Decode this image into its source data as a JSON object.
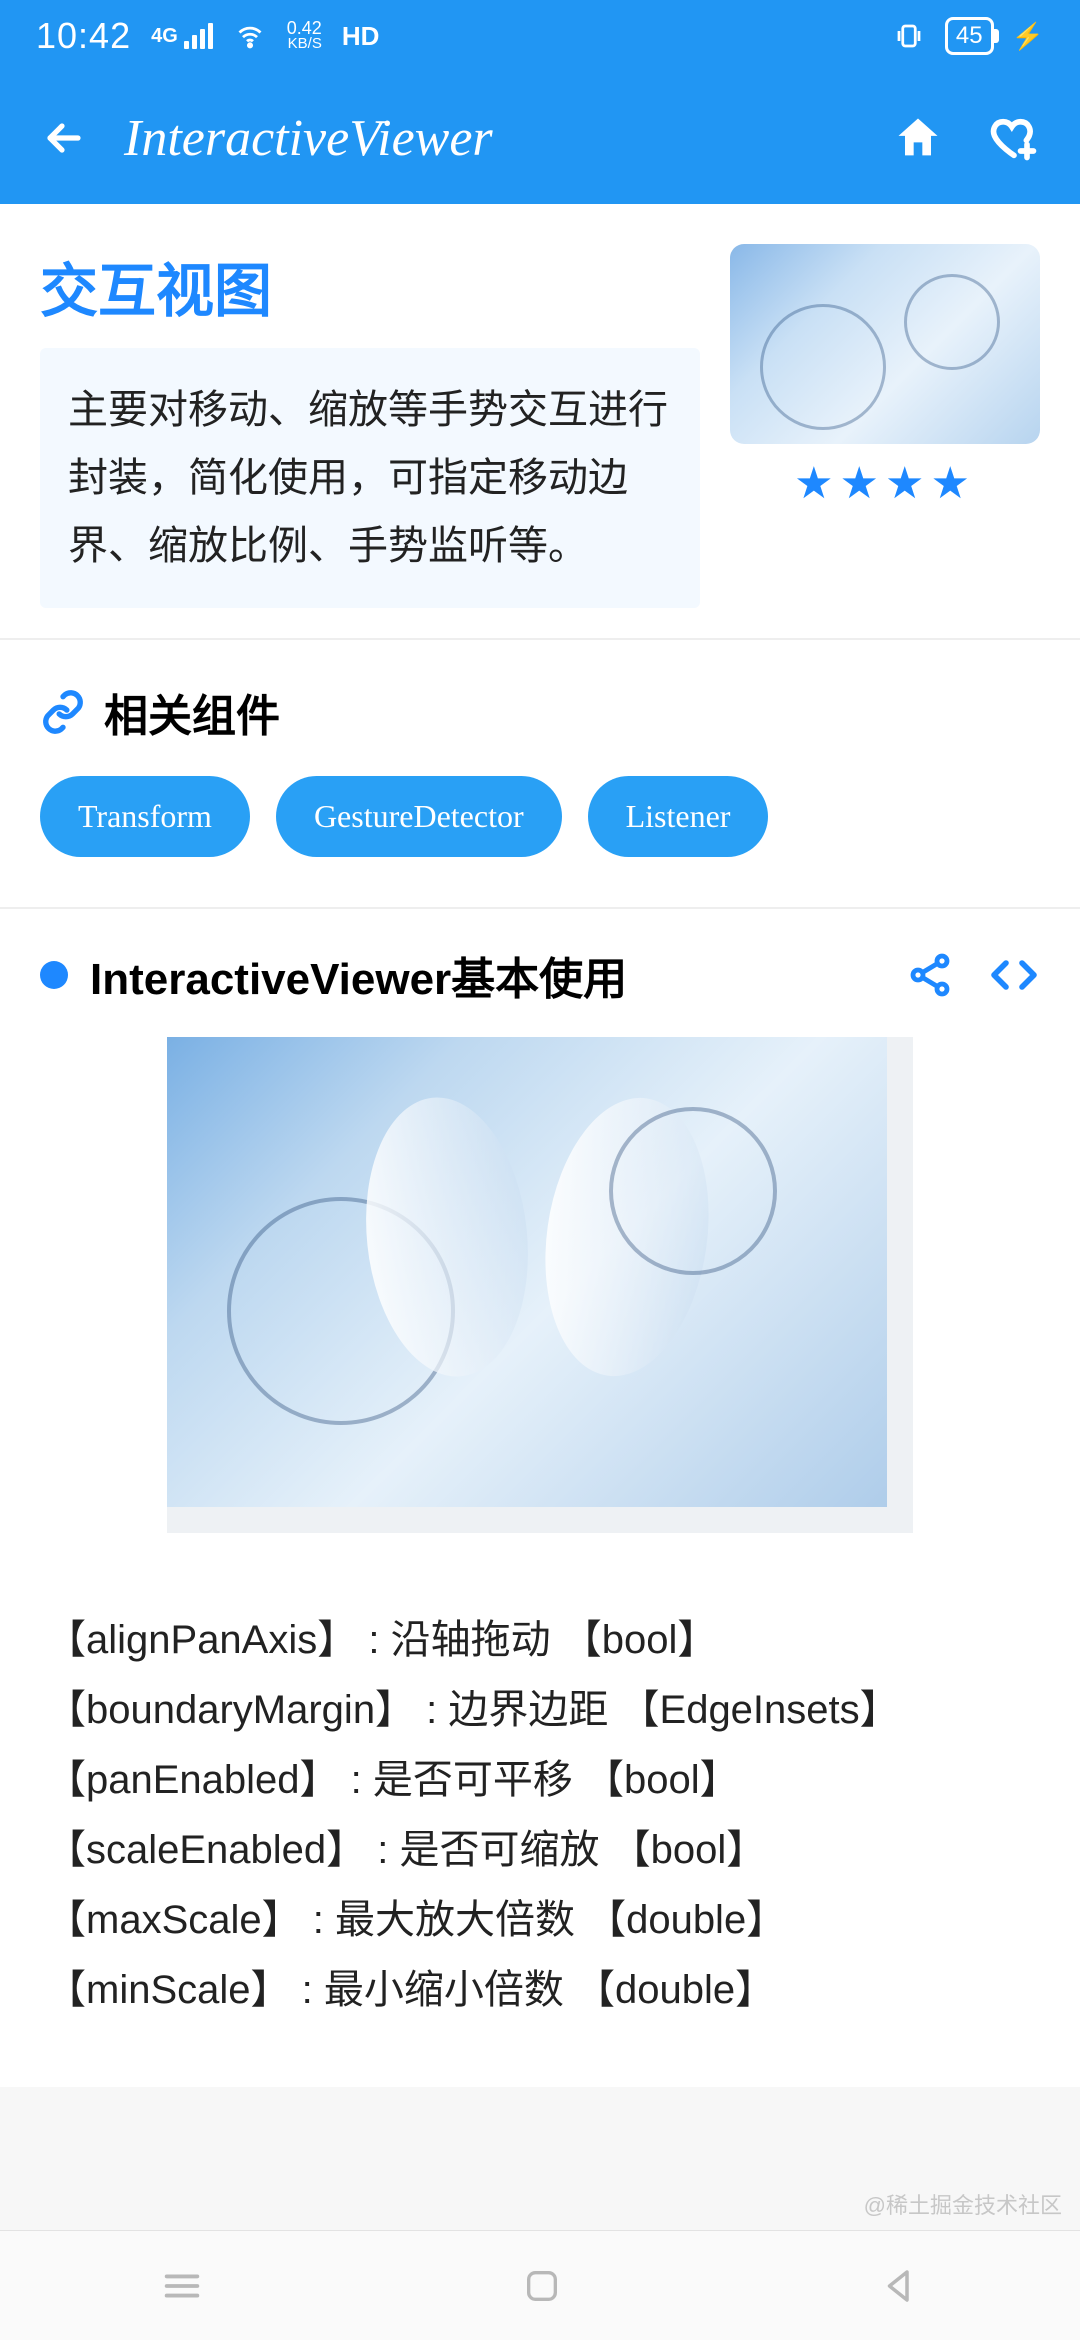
{
  "status": {
    "time": "10:42",
    "net_mode": "4G",
    "speed_value": "0.42",
    "speed_unit": "KB/S",
    "hd": "HD",
    "battery": "45"
  },
  "appbar": {
    "title": "InteractiveViewer"
  },
  "summary": {
    "title": "交互视图",
    "description": "主要对移动、缩放等手势交互进行封装，简化使用，可指定移动边界、缩放比例、手势监听等。",
    "stars": "★★★★"
  },
  "related": {
    "heading": "相关组件",
    "chips": [
      "Transform",
      "GestureDetector",
      "Listener"
    ]
  },
  "example": {
    "title": "InteractiveViewer基本使用"
  },
  "props": [
    "【alignPanAxis】 : 沿轴拖动    【bool】",
    "【boundaryMargin】 : 边界边距    【EdgeInsets】",
    "【panEnabled】 : 是否可平移    【bool】",
    "【scaleEnabled】 : 是否可缩放    【bool】",
    "【maxScale】 : 最大放大倍数    【double】",
    "【minScale】 : 最小缩小倍数    【double】"
  ],
  "watermark": "@稀土掘金技术社区"
}
